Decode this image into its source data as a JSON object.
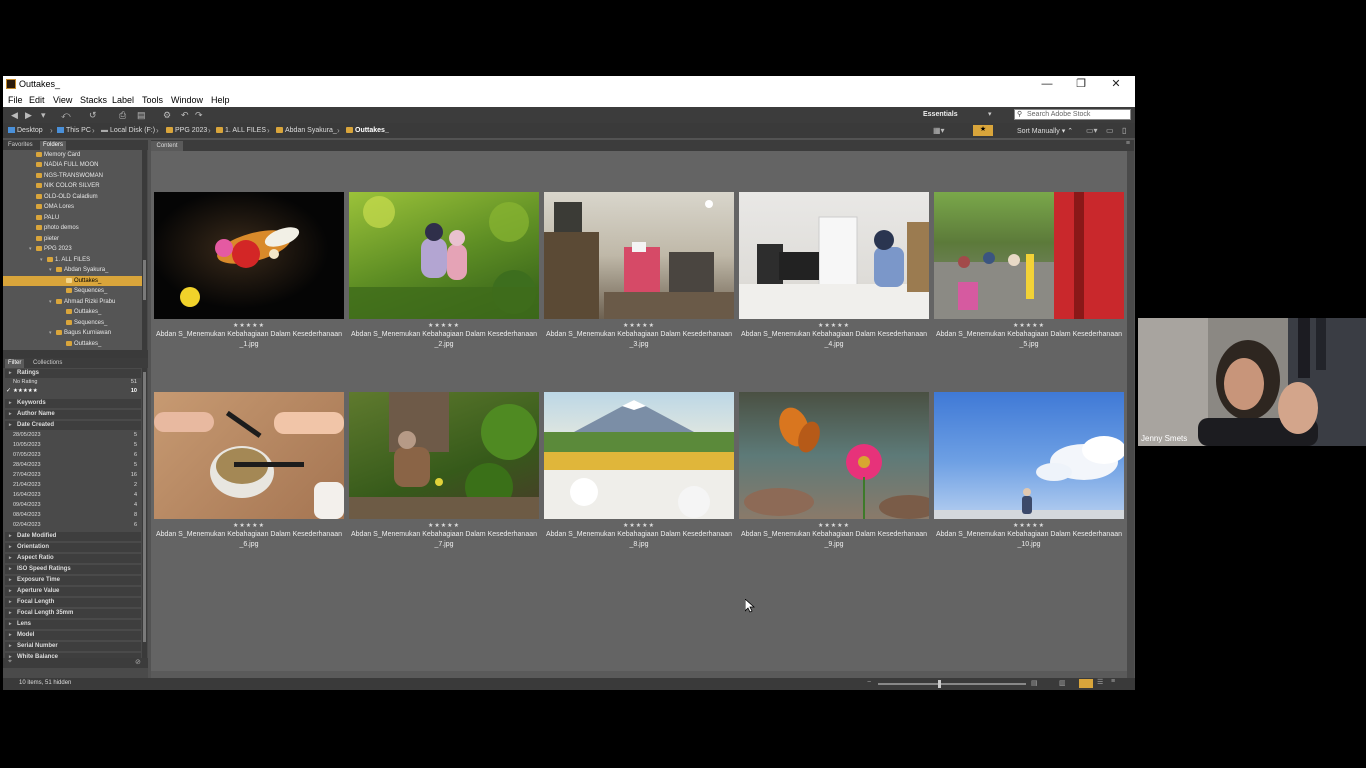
{
  "window": {
    "title": "Outtakes_",
    "controls": [
      "—",
      "❐",
      "✕"
    ]
  },
  "menu": [
    "File",
    "Edit",
    "View",
    "Stacks",
    "Label",
    "Tools",
    "Window",
    "Help"
  ],
  "toolbar": {
    "workspace": "Essentials",
    "search_placeholder": "Search Adobe Stock"
  },
  "path": [
    "Desktop",
    "This PC",
    "Local Disk (F:)",
    "PPG 2023",
    "1. ALL FILES",
    "Abdan Syakura_",
    "Outtakes_"
  ],
  "sort_label": "Sort Manually",
  "panel_tabs": {
    "favorites": "Favorites",
    "folders": "Folders",
    "filter": "Filter",
    "collections": "Collections"
  },
  "folders": [
    "Memory Card",
    "NADIA FULL MOON",
    "NGS-TRANSWOMAN",
    "NIK COLOR SILVER",
    "OLD-OLD Caladium",
    "OMA Lores",
    "PALU",
    "photo demos",
    "pieter",
    "PPG 2023",
    "1. ALL FILES",
    "Abdan Syakura_",
    "Outtakes_",
    "Sequences_",
    "Ahmad Rizki Prabu",
    "Outtakes_",
    "Sequences_",
    "Bagus Kurniawan",
    "Outtakes_"
  ],
  "filter": {
    "ratings_header": "Ratings",
    "ratings": [
      {
        "label": "No Rating",
        "count": "51"
      },
      {
        "label": "★★★★★",
        "count": "10"
      }
    ],
    "keywords_header": "Keywords",
    "author_header": "Author Name",
    "date_header": "Date Created",
    "dates": [
      {
        "label": "28/05/2023",
        "count": "5"
      },
      {
        "label": "10/05/2023",
        "count": "5"
      },
      {
        "label": "07/05/2023",
        "count": "6"
      },
      {
        "label": "28/04/2023",
        "count": "5"
      },
      {
        "label": "27/04/2023",
        "count": "16"
      },
      {
        "label": "21/04/2023",
        "count": "2"
      },
      {
        "label": "16/04/2023",
        "count": "4"
      },
      {
        "label": "09/04/2023",
        "count": "4"
      },
      {
        "label": "08/04/2023",
        "count": "8"
      },
      {
        "label": "02/04/2023",
        "count": "6"
      }
    ],
    "more_headers": [
      "Date Modified",
      "Orientation",
      "Aspect Ratio",
      "ISO Speed Ratings",
      "Exposure Time",
      "Aperture Value",
      "Focal Length",
      "Focal Length 35mm",
      "Lens",
      "Model",
      "Serial Number",
      "White Balance"
    ]
  },
  "content_tab": "Content",
  "thumbnails": [
    {
      "rating": "★★★★★",
      "name_line1": "Abdan S_Menemukan Kebahagiaan Dalam Kesederhanaan",
      "name_line2": "_1.jpg"
    },
    {
      "rating": "★★★★★",
      "name_line1": "Abdan S_Menemukan Kebahagiaan Dalam Kesederhanaan",
      "name_line2": "_2.jpg"
    },
    {
      "rating": "★★★★★",
      "name_line1": "Abdan S_Menemukan Kebahagiaan Dalam Kesederhanaan",
      "name_line2": "_3.jpg"
    },
    {
      "rating": "★★★★★",
      "name_line1": "Abdan S_Menemukan Kebahagiaan Dalam Kesederhanaan",
      "name_line2": "_4.jpg"
    },
    {
      "rating": "★★★★★",
      "name_line1": "Abdan S_Menemukan Kebahagiaan Dalam Kesederhanaan",
      "name_line2": "_5.jpg"
    },
    {
      "rating": "★★★★★",
      "name_line1": "Abdan S_Menemukan Kebahagiaan Dalam Kesederhanaan",
      "name_line2": "_6.jpg"
    },
    {
      "rating": "★★★★★",
      "name_line1": "Abdan S_Menemukan Kebahagiaan Dalam Kesederhanaan",
      "name_line2": "_7.jpg"
    },
    {
      "rating": "★★★★★",
      "name_line1": "Abdan S_Menemukan Kebahagiaan Dalam Kesederhanaan",
      "name_line2": "_8.jpg"
    },
    {
      "rating": "★★★★★",
      "name_line1": "Abdan S_Menemukan Kebahagiaan Dalam Kesederhanaan",
      "name_line2": "_9.jpg"
    },
    {
      "rating": "★★★★★",
      "name_line1": "Abdan S_Menemukan Kebahagiaan Dalam Kesederhanaan",
      "name_line2": "_10.jpg"
    }
  ],
  "status": "10 items, 51 hidden",
  "video": {
    "participant": "Jenny Smets"
  },
  "colors": {
    "accent": "#d9a53b",
    "panel": "#4a4a4a",
    "content": "#646464"
  }
}
